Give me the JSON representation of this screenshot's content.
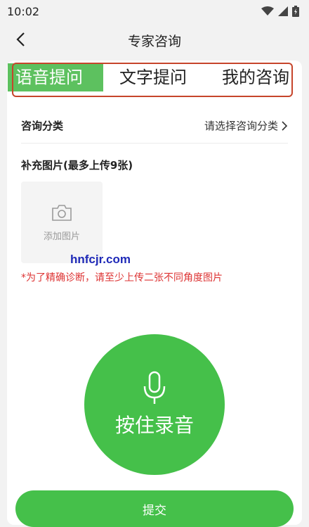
{
  "status_bar": {
    "time": "10:02",
    "icons": [
      "wifi-icon",
      "signal-icon",
      "battery-icon"
    ]
  },
  "nav": {
    "title": "专家咨询",
    "back_icon": "back-arrow-icon"
  },
  "tabs": [
    {
      "label": "语音提问",
      "active": true
    },
    {
      "label": "文字提问",
      "active": false
    },
    {
      "label": "我的咨询",
      "active": false
    }
  ],
  "category": {
    "label": "咨询分类",
    "placeholder": "请选择咨询分类"
  },
  "pictures": {
    "label": "补充图片(最多上传9张)",
    "add_label": "添加图片"
  },
  "watermark": "hnfcjr.com",
  "note": "*为了精确诊断，请至少上传二张不同角度图片",
  "record": {
    "label": "按住录音"
  },
  "submit": {
    "label": "提交"
  },
  "colors": {
    "accent": "#45c04a",
    "tab_active": "#5dc15f",
    "highlight_box": "#c6452b",
    "note": "#dd3333"
  }
}
